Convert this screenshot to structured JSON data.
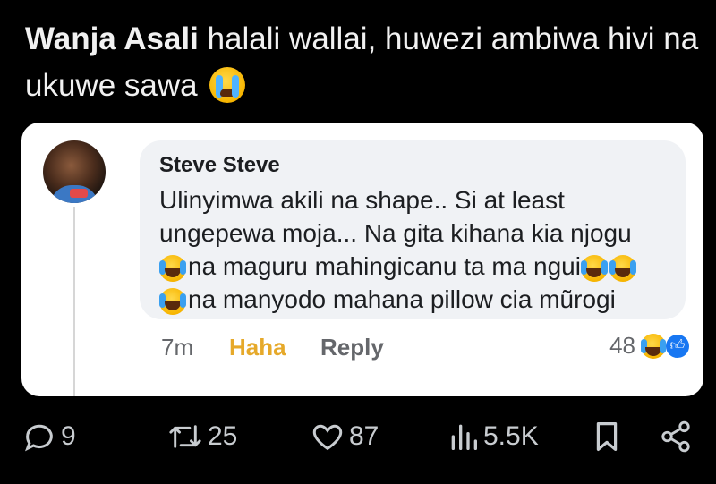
{
  "tweet": {
    "author": "Wanja Asali",
    "text": "halali wallai, huwezi ambiwa hivi na ukuwe sawa",
    "emoji": "crying-face"
  },
  "comment": {
    "name": "Steve Steve",
    "line1": "Ulinyimwa akili na shape.. Si at least",
    "line2": "ungepewa moja... Na gita kihana kia njogu",
    "line3": "na maguru mahingicanu ta ma ngui",
    "line4": "na manyodo mahana pillow cia mũrogi",
    "time": "7m",
    "haha_label": "Haha",
    "reply_label": "Reply",
    "reaction_count": "48"
  },
  "actions": {
    "replies": "9",
    "reposts": "25",
    "likes": "87",
    "views": "5.5K"
  },
  "colors": {
    "background": "#000000",
    "card": "#ffffff",
    "bubble": "#f0f2f5",
    "haha": "#e6a92a",
    "like_blue": "#1877f2"
  }
}
